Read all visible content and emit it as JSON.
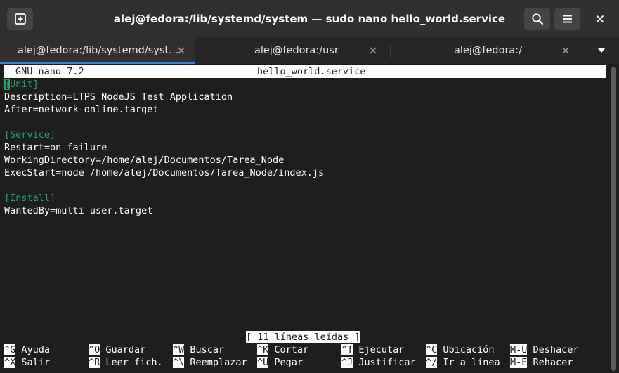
{
  "window": {
    "title": "alej@fedora:/lib/systemd/system — sudo nano hello_world.service",
    "icons": {
      "new_tab": "new-tab-icon",
      "search": "search-icon",
      "menu": "hamburger-menu-icon",
      "close": "close-icon"
    }
  },
  "tabs": [
    {
      "label": "alej@fedora:/lib/systemd/syst…",
      "active": true
    },
    {
      "label": "alej@fedora:/usr",
      "active": false
    },
    {
      "label": "alej@fedora:/",
      "active": false
    }
  ],
  "colors": {
    "accent": "#3584e4",
    "section_header": "#26a269",
    "background": "#1e1e1e",
    "headerbar": "#303030"
  },
  "nano": {
    "version": "GNU nano 7.2",
    "filename": "hello_world.service",
    "cursor_char": "[",
    "lines": [
      {
        "text": "Unit]",
        "section": true,
        "cursor": true
      },
      {
        "text": "Description=LTPS NodeJS Test Application",
        "section": false
      },
      {
        "text": "After=network-online.target",
        "section": false
      },
      {
        "text": "",
        "section": false
      },
      {
        "text": "[Service]",
        "section": true
      },
      {
        "text": "Restart=on-failure",
        "section": false
      },
      {
        "text": "WorkingDirectory=/home/alej/Documentos/Tarea_Node",
        "section": false
      },
      {
        "text": "ExecStart=node /home/alej/Documentos/Tarea_Node/index.js",
        "section": false
      },
      {
        "text": "",
        "section": false
      },
      {
        "text": "[Install]",
        "section": true
      },
      {
        "text": "WantedBy=multi-user.target",
        "section": false
      }
    ],
    "status": "[ 11 líneas leídas ]",
    "shortcuts_row1": [
      {
        "key": "^G",
        "label": "Ayuda"
      },
      {
        "key": "^O",
        "label": "Guardar"
      },
      {
        "key": "^W",
        "label": "Buscar"
      },
      {
        "key": "^K",
        "label": "Cortar"
      },
      {
        "key": "^T",
        "label": "Ejecutar"
      },
      {
        "key": "^C",
        "label": "Ubicación"
      },
      {
        "key": "M-U",
        "label": "Deshacer"
      }
    ],
    "shortcuts_row2": [
      {
        "key": "^X",
        "label": "Salir"
      },
      {
        "key": "^R",
        "label": "Leer fich."
      },
      {
        "key": "^\\",
        "label": "Reemplazar"
      },
      {
        "key": "^U",
        "label": "Pegar"
      },
      {
        "key": "^J",
        "label": "Justificar"
      },
      {
        "key": "^/",
        "label": "Ir a línea"
      },
      {
        "key": "M-E",
        "label": "Rehacer"
      }
    ]
  }
}
